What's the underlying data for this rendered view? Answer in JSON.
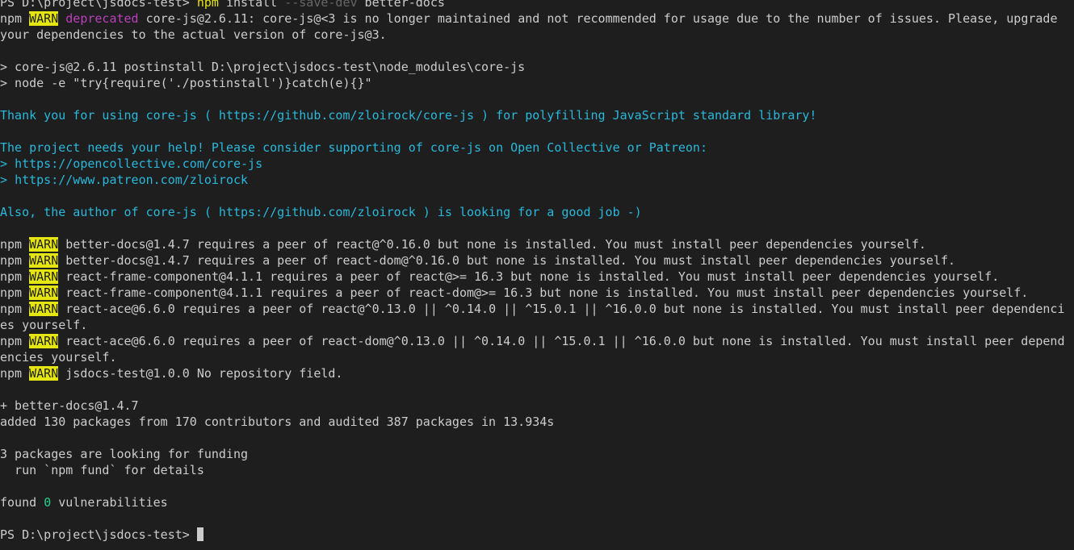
{
  "terminal": {
    "lines": [
      [
        {
          "t": "PS D:\\project\\jsdocs-test> "
        },
        {
          "t": "npm",
          "c": "yellow"
        },
        {
          "t": " install "
        },
        {
          "t": "--save-dev",
          "c": "dim"
        },
        {
          "t": " better-docs"
        }
      ],
      [
        {
          "t": "npm "
        },
        {
          "t": "WARN",
          "c": "warn"
        },
        {
          "t": " "
        },
        {
          "t": "deprecated",
          "c": "magenta"
        },
        {
          "t": " core-js@2.6.11: core-js@<3 is no longer maintained and not recommended for usage due to the number of issues. Please, upgrade"
        }
      ],
      [
        {
          "t": "your dependencies to the actual version of core-js@3."
        }
      ],
      [],
      [
        {
          "t": "> core-js@2.6.11 postinstall D:\\project\\jsdocs-test\\node_modules\\core-js"
        }
      ],
      [
        {
          "t": "> node -e \"try{require('./postinstall')}catch(e){}\""
        }
      ],
      [],
      [
        {
          "t": "Thank you for using core-js ( https://github.com/zloirock/core-js ) for polyfilling JavaScript standard library!",
          "c": "cyan"
        }
      ],
      [],
      [
        {
          "t": "The project needs your help! Please consider supporting of core-js on Open Collective or Patreon:",
          "c": "cyan"
        }
      ],
      [
        {
          "t": "> ",
          "c": "cyan"
        },
        {
          "t": "https://opencollective.com/core-js",
          "c": "cyan"
        }
      ],
      [
        {
          "t": "> ",
          "c": "cyan"
        },
        {
          "t": "https://www.patreon.com/zloirock",
          "c": "cyan"
        }
      ],
      [],
      [
        {
          "t": "Also, the author of core-js ( https://github.com/zloirock ) is looking for a good job -)",
          "c": "cyan"
        }
      ],
      [],
      [
        {
          "t": "npm "
        },
        {
          "t": "WARN",
          "c": "warn"
        },
        {
          "t": " better-docs@1.4.7 requires a peer of react@^0.16.0 but none is installed. You must install peer dependencies yourself."
        }
      ],
      [
        {
          "t": "npm "
        },
        {
          "t": "WARN",
          "c": "warn"
        },
        {
          "t": " better-docs@1.4.7 requires a peer of react-dom@^0.16.0 but none is installed. You must install peer dependencies yourself."
        }
      ],
      [
        {
          "t": "npm "
        },
        {
          "t": "WARN",
          "c": "warn"
        },
        {
          "t": " react-frame-component@4.1.1 requires a peer of react@>= 16.3 but none is installed. You must install peer dependencies yourself."
        }
      ],
      [
        {
          "t": "npm "
        },
        {
          "t": "WARN",
          "c": "warn"
        },
        {
          "t": " react-frame-component@4.1.1 requires a peer of react-dom@>= 16.3 but none is installed. You must install peer dependencies yourself."
        }
      ],
      [
        {
          "t": "npm "
        },
        {
          "t": "WARN",
          "c": "warn"
        },
        {
          "t": " react-ace@6.6.0 requires a peer of react@^0.13.0 || ^0.14.0 || ^15.0.1 || ^16.0.0 but none is installed. You must install peer dependenci"
        }
      ],
      [
        {
          "t": "es yourself."
        }
      ],
      [
        {
          "t": "npm "
        },
        {
          "t": "WARN",
          "c": "warn"
        },
        {
          "t": " react-ace@6.6.0 requires a peer of react-dom@^0.13.0 || ^0.14.0 || ^15.0.1 || ^16.0.0 but none is installed. You must install peer depend"
        }
      ],
      [
        {
          "t": "encies yourself."
        }
      ],
      [
        {
          "t": "npm "
        },
        {
          "t": "WARN",
          "c": "warn"
        },
        {
          "t": " jsdocs-test@1.0.0 No repository field."
        }
      ],
      [],
      [
        {
          "t": "+ better-docs@1.4.7"
        }
      ],
      [
        {
          "t": "added 130 packages from 170 contributors and audited 387 packages in 13.934s"
        }
      ],
      [],
      [
        {
          "t": "3 packages are looking for funding"
        }
      ],
      [
        {
          "t": "  run `npm fund` for details"
        }
      ],
      [],
      [
        {
          "t": "found "
        },
        {
          "t": "0",
          "c": "green"
        },
        {
          "t": " vulnerabilities"
        }
      ],
      [],
      [
        {
          "t": "PS D:\\project\\jsdocs-test> "
        }
      ]
    ],
    "colors": {
      "background": "#1e1e1e",
      "foreground": "#cccccc",
      "cyan": "#29b8db",
      "yellow": "#e5e510",
      "magenta": "#bc3fbc",
      "green": "#23d18b",
      "dim": "#666666"
    }
  }
}
